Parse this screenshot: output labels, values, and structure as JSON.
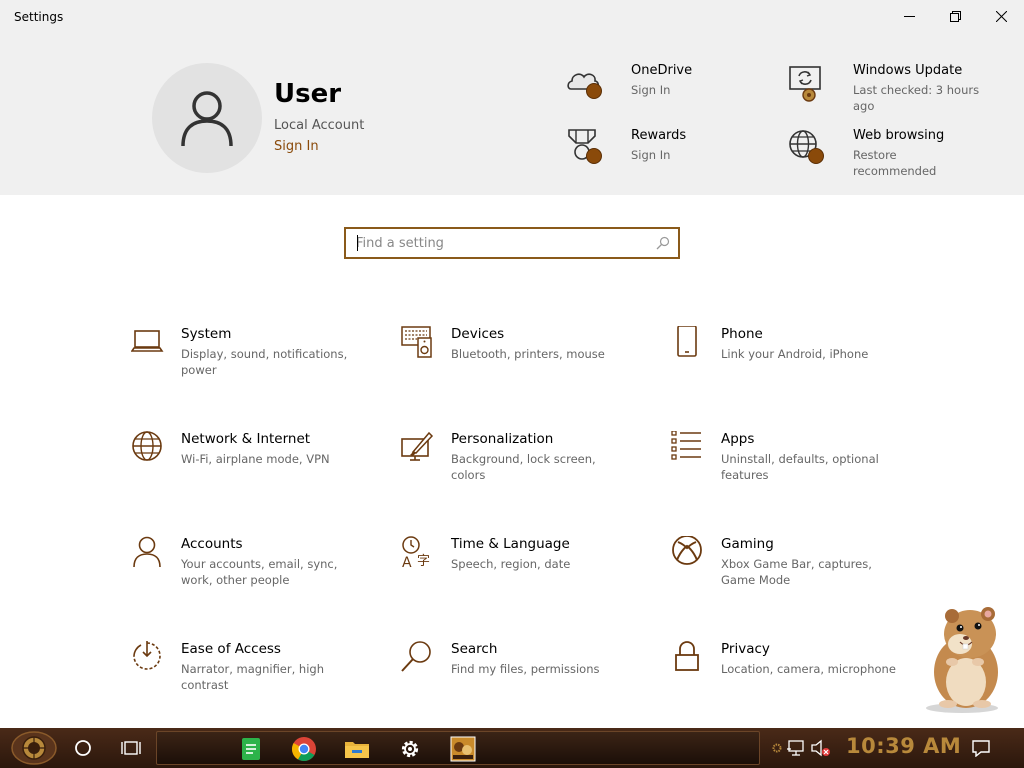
{
  "window": {
    "title": "Settings"
  },
  "user": {
    "name": "User",
    "account_type": "Local Account",
    "signin_label": "Sign In"
  },
  "header_cards": [
    {
      "title": "OneDrive",
      "subtitle": "Sign In",
      "icon": "cloud-icon"
    },
    {
      "title": "Windows Update",
      "subtitle": "Last checked: 3 hours ago",
      "icon": "update-icon"
    },
    {
      "title": "Rewards",
      "subtitle": "Sign In",
      "icon": "trophy-icon"
    },
    {
      "title": "Web browsing",
      "subtitle": "Restore recommended",
      "icon": "globe-icon"
    }
  ],
  "search": {
    "placeholder": "Find a setting"
  },
  "tiles": [
    {
      "title": "System",
      "desc": "Display, sound, notifications, power",
      "icon": "laptop-icon"
    },
    {
      "title": "Devices",
      "desc": "Bluetooth, printers, mouse",
      "icon": "devices-icon"
    },
    {
      "title": "Phone",
      "desc": "Link your Android, iPhone",
      "icon": "phone-icon"
    },
    {
      "title": "Network & Internet",
      "desc": "Wi-Fi, airplane mode, VPN",
      "icon": "globe-icon"
    },
    {
      "title": "Personalization",
      "desc": "Background, lock screen, colors",
      "icon": "paint-icon"
    },
    {
      "title": "Apps",
      "desc": "Uninstall, defaults, optional features",
      "icon": "apps-list-icon"
    },
    {
      "title": "Accounts",
      "desc": "Your accounts, email, sync, work, other people",
      "icon": "person-icon"
    },
    {
      "title": "Time & Language",
      "desc": "Speech, region, date",
      "icon": "time-language-icon"
    },
    {
      "title": "Gaming",
      "desc": "Xbox Game Bar, captures, Game Mode",
      "icon": "xbox-icon"
    },
    {
      "title": "Ease of Access",
      "desc": "Narrator, magnifier, high contrast",
      "icon": "ease-of-access-icon"
    },
    {
      "title": "Search",
      "desc": "Find my files, permissions",
      "icon": "search-icon"
    },
    {
      "title": "Privacy",
      "desc": "Location, camera, microphone",
      "icon": "lock-icon"
    }
  ],
  "taskbar": {
    "clock": "10:39 AM",
    "apps": [
      "sheets-icon",
      "chrome-icon",
      "file-explorer-icon",
      "settings-gear-icon",
      "game-app-icon"
    ]
  },
  "colors": {
    "accent": "#8a4a0a",
    "icon_brown": "#6b3a10",
    "header_bg": "#f0f0f0",
    "taskbar_bg": "#3a2012",
    "clock": "#b8893b"
  }
}
